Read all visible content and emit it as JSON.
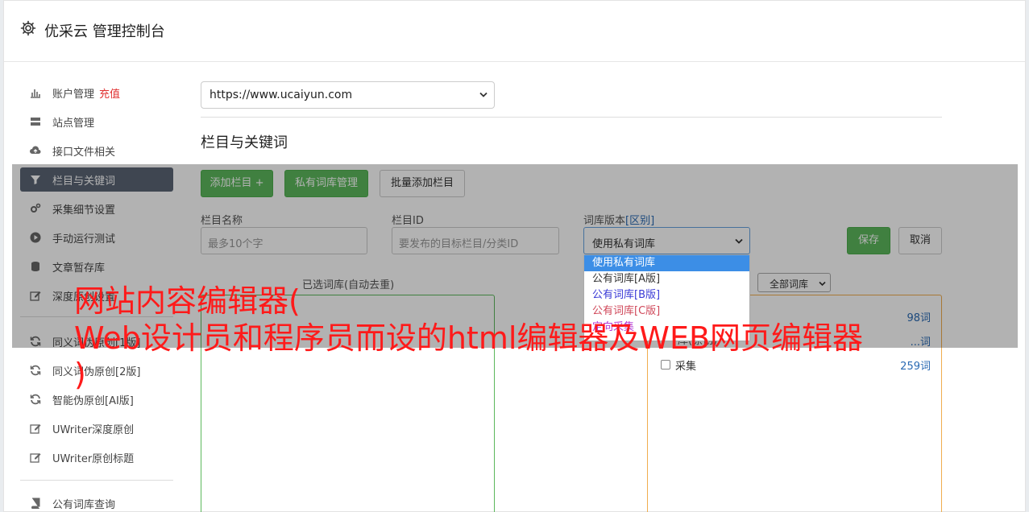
{
  "header": {
    "title": "优采云 管理控制台",
    "icon": "gear-icon"
  },
  "sidebar": {
    "items": [
      {
        "label": "账户管理",
        "badge": "充值",
        "icon": "bar-chart-icon"
      },
      {
        "label": "站点管理",
        "icon": "server-icon"
      },
      {
        "label": "接口文件相关",
        "icon": "cloud-upload-icon"
      },
      {
        "label": "栏目与关键词",
        "icon": "filter-icon",
        "active": true
      },
      {
        "label": "采集细节设置",
        "icon": "cogs-icon"
      },
      {
        "label": "手动运行测试",
        "icon": "play-icon"
      },
      {
        "label": "文章暂存库",
        "icon": "database-icon"
      },
      {
        "label": "深度原创设置",
        "icon": "edit-icon"
      },
      {
        "label": "同义词伪原创[1版]",
        "icon": "refresh-icon"
      },
      {
        "label": "同义词伪原创[2版]",
        "icon": "refresh-icon"
      },
      {
        "label": "智能伪原创[AI版]",
        "icon": "refresh-icon"
      },
      {
        "label": "UWriter深度原创",
        "icon": "edit-icon"
      },
      {
        "label": "UWriter原创标题",
        "icon": "edit-icon"
      },
      {
        "label": "公有词库查询",
        "icon": "book-icon"
      }
    ]
  },
  "main": {
    "site_select": {
      "value": "https://www.ucaiyun.com"
    },
    "section_title": "栏目与关键词",
    "buttons": {
      "add_column": "添加栏目 +",
      "private_lib": "私有词库管理",
      "batch_add": "批量添加栏目",
      "save": "保存",
      "cancel": "取消"
    },
    "form": {
      "column_name_label": "栏目名称",
      "column_name_placeholder": "最多10个字",
      "column_id_label": "栏目ID",
      "column_id_placeholder": "要发布的目标栏目/分类ID",
      "lib_version_label": "词库版本",
      "lib_version_link": "[区别]",
      "lib_version_value": "使用私有词库",
      "lib_version_options": [
        {
          "label": "使用私有词库",
          "color": "#ffffff"
        },
        {
          "label": "公有词库[A版]",
          "color": "#333333"
        },
        {
          "label": "公有词库[B版]",
          "color": "#3a3ad6"
        },
        {
          "label": "公有词库[C版]",
          "color": "#d0485a"
        },
        {
          "label": "定向采集",
          "color": "#b43ad6"
        }
      ]
    },
    "selected_lib_label": "已选词库(自动去重)",
    "lib_filter": "全部词库",
    "right_label_partial": "库(原创)",
    "libraries": [
      {
        "name": "",
        "count": "98词"
      },
      {
        "name": "",
        "count": "...词"
      },
      {
        "name": "采集",
        "count": "259词"
      }
    ]
  },
  "watermark": {
    "line1": "网站内容编辑器(",
    "line2": "Web设计员和程序员而设的html编辑器及WEB网页编辑器",
    "line3": ")"
  }
}
